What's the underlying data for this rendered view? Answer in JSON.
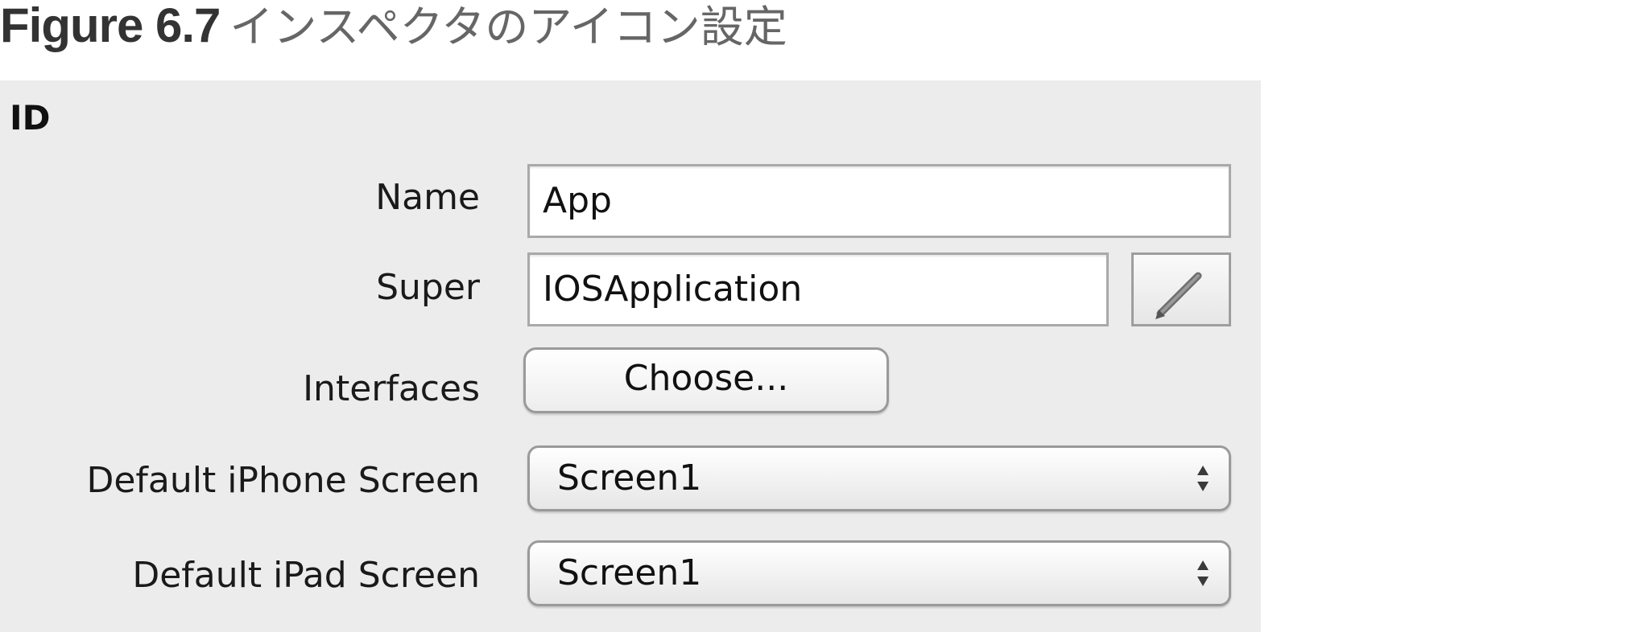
{
  "caption": {
    "figure_label": "Figure 6.7",
    "title": "インスペクタのアイコン設定"
  },
  "inspector": {
    "section_title": "ID",
    "name": {
      "label": "Name",
      "value": "App"
    },
    "super": {
      "label": "Super",
      "value": "IOSApplication",
      "edit_icon": "pencil-icon"
    },
    "interfaces": {
      "label": "Interfaces",
      "button_label": "Choose..."
    },
    "default_iphone_screen": {
      "label": "Default iPhone Screen",
      "selected": "Screen1",
      "icon": "up-down-arrows-icon"
    },
    "default_ipad_screen": {
      "label": "Default iPad Screen",
      "selected": "Screen1",
      "icon": "up-down-arrows-icon"
    }
  },
  "colors": {
    "panel_background": "#ececec",
    "caption_bold": "#333333",
    "caption_title": "#666666"
  }
}
